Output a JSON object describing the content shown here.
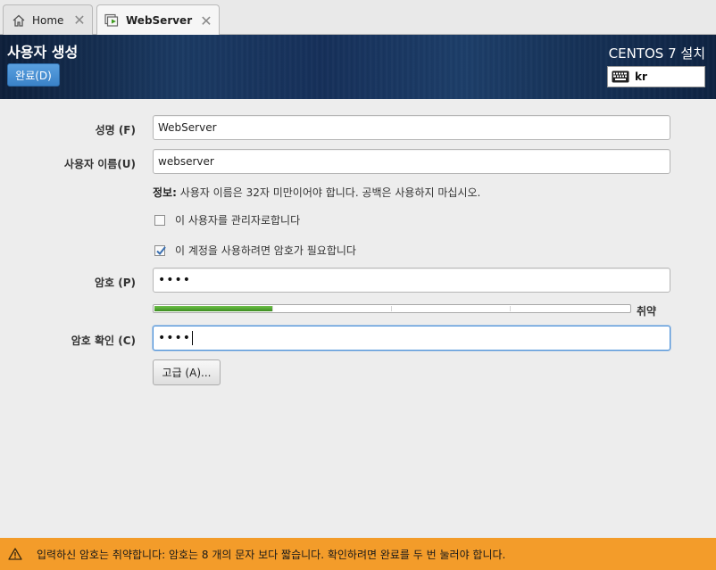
{
  "tabs": [
    {
      "label": "Home",
      "icon": "home-icon"
    },
    {
      "label": "WebServer",
      "icon": "vm-play-icon"
    }
  ],
  "header": {
    "title": "사용자 생성",
    "done_label": "완료(D)",
    "install_title": "CENTOS 7 설치",
    "keyboard_layout": "kr"
  },
  "form": {
    "fullname_label": "성명 (F)",
    "fullname_value": "WebServer",
    "username_label": "사용자 이름(U)",
    "username_value": "webserver",
    "info_prefix": "정보:",
    "info_text": " 사용자 이름은 32자 미만이어야 합니다. 공백은 사용하지 마십시오.",
    "admin_check_label": "이 사용자를 관리자로합니다",
    "admin_checked": false,
    "require_password_label": "이 계정을 사용하려면 암호가 필요합니다",
    "require_password_checked": true,
    "password_label": "암호 (P)",
    "password_value": "••••",
    "strength_fraction": 0.25,
    "strength_label": "취약",
    "confirm_label": "암호 확인 (C)",
    "confirm_value": "••••",
    "advanced_label": "고급 (A)..."
  },
  "warning": {
    "text": "입력하신 암호는 취약합니다: 암호는 8 개의 문자 보다 짧습니다. 확인하려면 완료를 두 번 눌러야 합니다."
  },
  "colors": {
    "accent_blue": "#3a82c8",
    "warning_orange": "#f39c2a",
    "strength_green": "#4a9a2a"
  }
}
